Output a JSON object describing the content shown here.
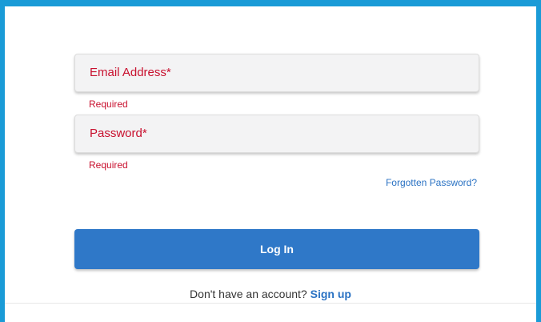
{
  "colors": {
    "frame_border": "#1a9bd7",
    "error_red": "#c8102e",
    "primary_blue": "#2f78c8",
    "link_blue": "#2a72c3"
  },
  "form": {
    "email": {
      "label": "Email Address*",
      "value": "",
      "error": "Required"
    },
    "password": {
      "label": "Password*",
      "value": "",
      "error": "Required"
    },
    "forgot_password_link": "Forgotten Password?",
    "login_button": "Log In",
    "signup_prompt": "Don't have an account?",
    "signup_link": "Sign up"
  }
}
